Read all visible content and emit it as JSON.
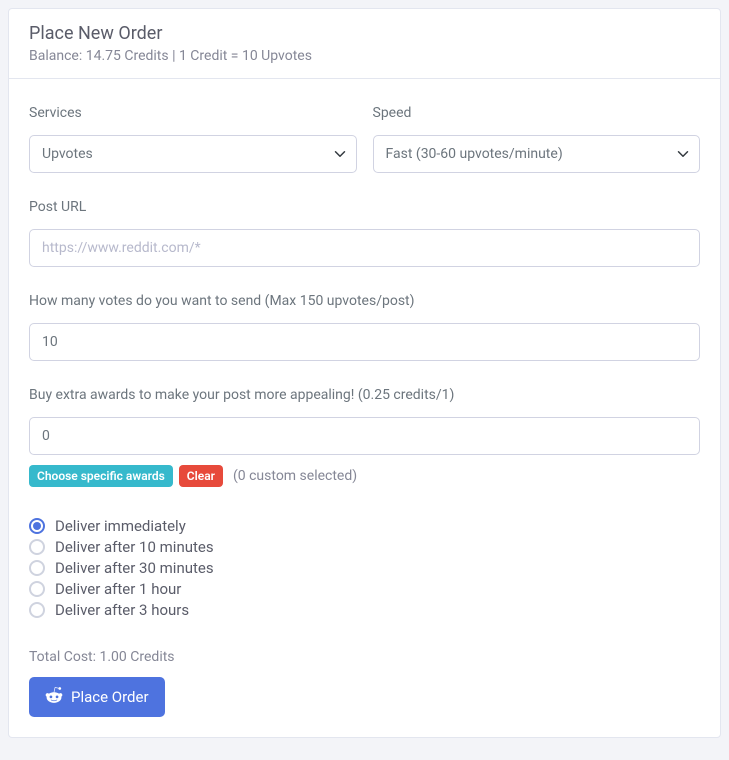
{
  "header": {
    "title": "Place New Order",
    "subtitle": "Balance: 14.75 Credits | 1 Credit = 10 Upvotes"
  },
  "services": {
    "label": "Services",
    "value": "Upvotes"
  },
  "speed": {
    "label": "Speed",
    "value": "Fast (30-60 upvotes/minute)"
  },
  "post_url": {
    "label": "Post URL",
    "placeholder": "https://www.reddit.com/*",
    "value": ""
  },
  "votes": {
    "label": "How many votes do you want to send (Max 150 upvotes/post)",
    "value": "10"
  },
  "awards": {
    "label": "Buy extra awards to make your post more appealing! (0.25 credits/1)",
    "value": "0",
    "choose_label": "Choose specific awards",
    "clear_label": "Clear",
    "selected_text": "(0 custom selected)"
  },
  "delivery": {
    "options": [
      {
        "label": "Deliver immediately",
        "checked": true
      },
      {
        "label": "Deliver after 10 minutes",
        "checked": false
      },
      {
        "label": "Deliver after 30 minutes",
        "checked": false
      },
      {
        "label": "Deliver after 1 hour",
        "checked": false
      },
      {
        "label": "Deliver after 3 hours",
        "checked": false
      }
    ]
  },
  "footer": {
    "total_cost": "Total Cost: 1.00 Credits",
    "button_label": "Place Order"
  }
}
